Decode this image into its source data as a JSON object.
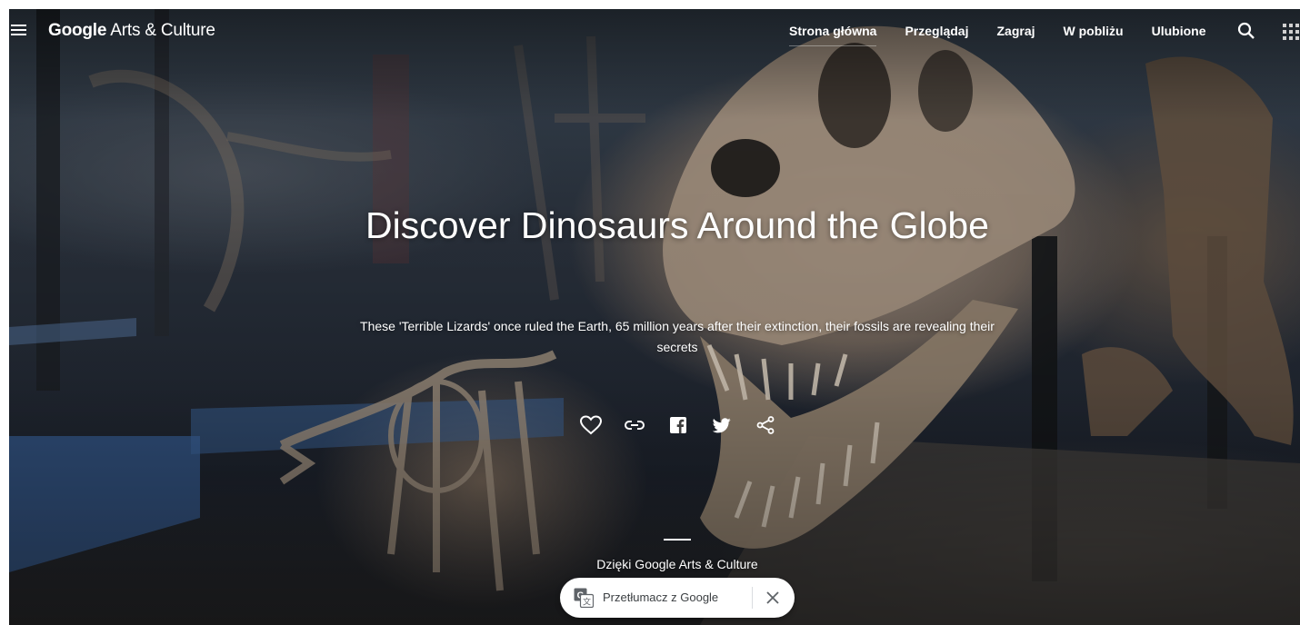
{
  "header": {
    "brand_bold": "Google",
    "brand_rest": " Arts & Culture",
    "nav": [
      {
        "label": "Strona główna",
        "active": true
      },
      {
        "label": "Przeglądaj",
        "active": false
      },
      {
        "label": "Zagraj",
        "active": false
      },
      {
        "label": "W pobliżu",
        "active": false
      },
      {
        "label": "Ulubione",
        "active": false
      }
    ],
    "icons": {
      "menu": "hamburger-menu-icon",
      "search": "search-icon",
      "apps": "apps-grid-icon"
    }
  },
  "hero": {
    "title": "Discover Dinosaurs Around the Globe",
    "subtitle": "These 'Terrible Lizards' once ruled the Earth, 65 million years after their extinction, their fossils are revealing their secrets",
    "actions": [
      "heart-icon",
      "link-icon",
      "facebook-icon",
      "twitter-icon",
      "share-icon"
    ],
    "credit": "Dzięki Google Arts & Culture"
  },
  "translate_bar": {
    "label": "Przetłumacz z Google",
    "icons": {
      "translate": "google-translate-icon",
      "close": "close-icon"
    }
  },
  "colors": {
    "text_on_hero": "#ffffff",
    "pill_background": "#ffffff",
    "pill_text": "#3c4043"
  }
}
